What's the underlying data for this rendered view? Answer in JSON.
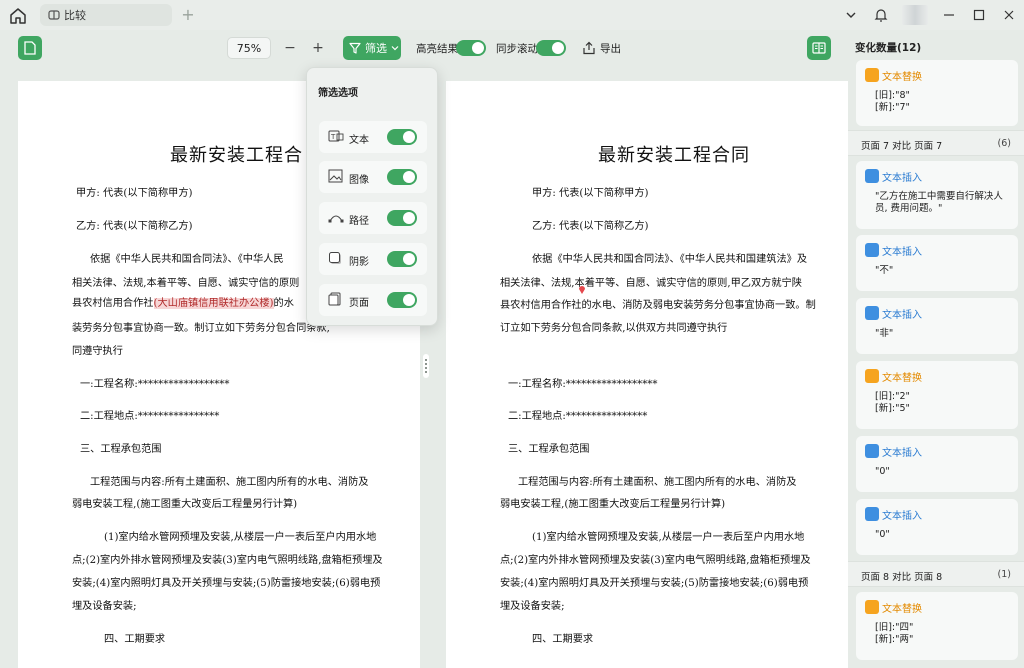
{
  "titlebar": {
    "tab_label": "比较",
    "tab_add": "+"
  },
  "toolbar": {
    "zoom": "75%",
    "zoom_out": "−",
    "zoom_in": "+",
    "filter_label": "筛选",
    "highlight_label": "高亮结果",
    "sync_scroll_label": "同步滚动",
    "export_label": "导出"
  },
  "filter_popup": {
    "title": "筛选选项",
    "options": [
      {
        "label": "文本",
        "on": true
      },
      {
        "label": "图像",
        "on": true
      },
      {
        "label": "路径",
        "on": true
      },
      {
        "label": "阴影",
        "on": true
      },
      {
        "label": "页面",
        "on": true
      }
    ]
  },
  "left_doc": {
    "title": "最新安装工程合",
    "party_a": "甲方: 代表(以下简称甲方)",
    "party_b": "乙方: 代表(以下简称乙方)",
    "p1_l1": "依据《中华人民共和国合同法》、《中华人民",
    "p1_l2": "相关法律、法规,本着平等、自愿、诚实守信的原则",
    "p1_l3_a": "县农村信用合作社",
    "p1_l3_hl": "(大山庙镇信用联社办公楼)",
    "p1_l3_b": "的水",
    "p1_l4": "装劳务分包事宜协商一致。制订立如下劳务分包合同条款,",
    "p1_l5": "同遵守执行",
    "item1": "一:工程名称:******************",
    "item2": "二:工程地点:****************",
    "item3": "三、工程承包范围",
    "p2_l1": "工程范围与内容:所有土建面积、施工图内所有的水电、消防及",
    "p2_l2": "弱电安装工程,(施工图重大改变后工程量另行计算)",
    "p3_l1": "(1)室内给水管网预埋及安装,从楼层一户一表后至户内用水地",
    "p3_l2": "点;(2)室内外排水管网预埋及安装(3)室内电气照明线路,盘箱柜预埋及",
    "p3_l3": "安装;(4)室内照明灯具及开关预埋与安装;(5)防雷接地安装;(6)弱电预",
    "p3_l4": "埋及设备安装;",
    "item4": "四、工期要求"
  },
  "right_doc": {
    "title": "最新安装工程合同",
    "party_a": "甲方: 代表(以下简称甲方)",
    "party_b": "乙方: 代表(以下简称乙方)",
    "p1_l1": "依据《中华人民共和国合同法》、《中华人民共和国建筑法》及",
    "p1_l2": "相关法律、法规,本着平等、自愿、诚实守信的原则,甲乙双方就宁陕",
    "p1_l3": "县农村信用合作社的水电、消防及弱电安装劳务分包事宜协商一致。制",
    "p1_l4": "订立如下劳务分包合同条款,以供双方共同遵守执行",
    "item1": "一:工程名称:******************",
    "item2": "二:工程地点:****************",
    "item3": "三、工程承包范围",
    "p2_l1": "工程范围与内容:所有土建面积、施工图内所有的水电、消防及",
    "p2_l2": "弱电安装工程,(施工图重大改变后工程量另行计算)",
    "p3_l1": "(1)室内给水管网预埋及安装,从楼层一户一表后至户内用水地",
    "p3_l2": "点;(2)室内外排水管网预埋及安装(3)室内电气照明线路,盘箱柜预埋及",
    "p3_l3": "安装;(4)室内照明灯具及开关预埋与安装;(5)防雷接地安装;(6)弱电预",
    "p3_l4": "埋及设备安装;",
    "item4": "四、工期要求"
  },
  "sidebar": {
    "header": "变化数量",
    "count": "(12)",
    "cards": [
      {
        "type": "文本替换",
        "body": "[旧]:\"8\"\n[新]:\"7\""
      },
      {
        "type": "文本插入",
        "body": "\"乙方在施工中需要自行解决人员, 费用问题。\""
      },
      {
        "type": "文本插入",
        "body": "\"不\""
      },
      {
        "type": "文本插入",
        "body": "\"非\""
      },
      {
        "type": "文本替换",
        "body": "[旧]:\"2\"\n[新]:\"5\""
      },
      {
        "type": "文本插入",
        "body": "\"0\""
      },
      {
        "type": "文本插入",
        "body": "\"0\""
      },
      {
        "type": "文本替换",
        "body": "[旧]:\"四\"\n[新]:\"两\""
      }
    ],
    "groups": [
      {
        "label": "页面 7 对比 页面 7",
        "count": "(6)"
      },
      {
        "label": "页面 8 对比 页面 8",
        "count": "(1)"
      }
    ]
  },
  "colors": {
    "accent": "#3fa661",
    "replace": "#f6a41f",
    "insert": "#3e8fe0",
    "highlight": "#f7d6d6"
  }
}
